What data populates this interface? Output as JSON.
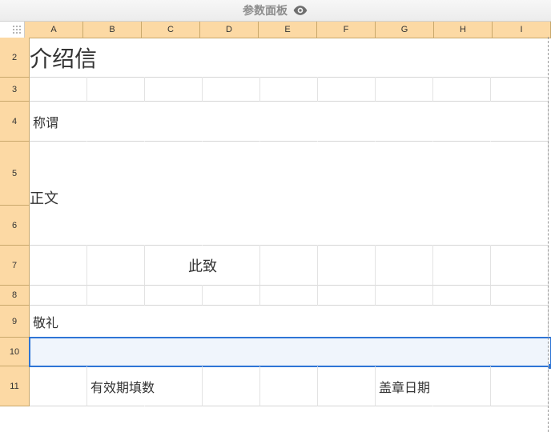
{
  "panel": {
    "title": "参数面板"
  },
  "columns": [
    "A",
    "B",
    "C",
    "D",
    "E",
    "F",
    "G",
    "H",
    "I"
  ],
  "rows": [
    "2",
    "3",
    "4",
    "5",
    "6",
    "7",
    "8",
    "9",
    "10",
    "11"
  ],
  "content": {
    "title_r2": "介绍信",
    "salutation_r4": "称谓",
    "body_r5_6": "正文",
    "closing_r7": "此致",
    "regards_r9": "敬礼",
    "validity_r11": "有效期填数",
    "seal_date_r11": "盖章日期"
  },
  "selection": {
    "row": "10",
    "cols": "A:I"
  }
}
